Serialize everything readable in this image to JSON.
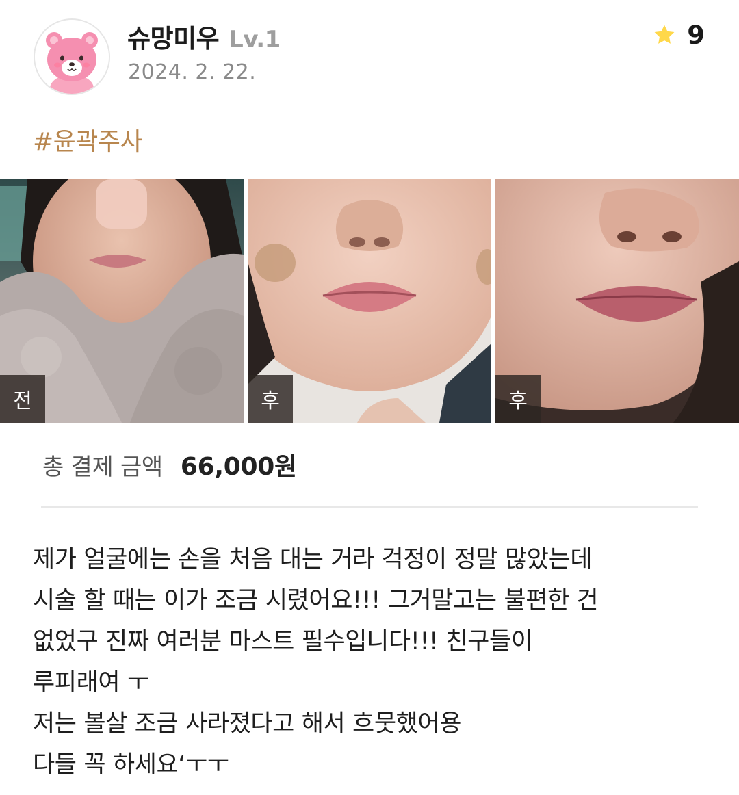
{
  "review": {
    "author": {
      "name": "슈망미우",
      "level": "Lv.1",
      "avatar_icon": "pink-bear-avatar-icon"
    },
    "date": "2024. 2. 22.",
    "rating": {
      "icon": "star-icon",
      "value": "9",
      "star_color": "#FFD84A"
    },
    "hashtag": "#윤곽주사",
    "hashtag_color": "#B8864E",
    "photos": [
      {
        "tag": "전"
      },
      {
        "tag": "후"
      },
      {
        "tag": "후"
      }
    ],
    "payment": {
      "label": "총 결제 금액",
      "amount": "66,000원"
    },
    "body_lines": [
      "제가 얼굴에는 손을 처음 대는 거라 걱정이 정말 많았는데",
      "시술 할 때는 이가 조금 시렸어요!!! 그거말고는 불편한 건",
      "없었구 진짜 여러분 마스트 필수입니다!!! 친구들이",
      "루피래여 ㅜ",
      "저는 볼살 조금 사라졌다고 해서 흐뭇했어용",
      "다들 꼭 하세요‘ㅜㅜ"
    ]
  }
}
